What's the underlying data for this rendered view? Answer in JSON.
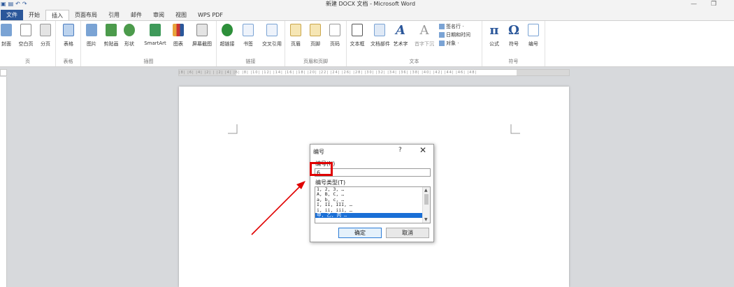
{
  "window": {
    "title": "新建 DOCX 文档 - Microsoft Word",
    "minimize_glyph": "—",
    "restore_glyph": "❐"
  },
  "tabs": [
    {
      "label": "文件"
    },
    {
      "label": "开始"
    },
    {
      "label": "插入"
    },
    {
      "label": "页面布局"
    },
    {
      "label": "引用"
    },
    {
      "label": "邮件"
    },
    {
      "label": "审阅"
    },
    {
      "label": "视图"
    },
    {
      "label": "WPS PDF"
    }
  ],
  "ribbon": {
    "groups": [
      {
        "label": "页",
        "buttons": [
          "封面",
          "空白页",
          "分页"
        ]
      },
      {
        "label": "表格",
        "buttons": [
          "表格"
        ]
      },
      {
        "label": "插图",
        "buttons": [
          "图片",
          "剪贴画",
          "形状",
          "SmartArt",
          "图表",
          "屏幕截图"
        ]
      },
      {
        "label": "链接",
        "buttons": [
          "超链接",
          "书签",
          "交叉引用"
        ]
      },
      {
        "label": "页眉和页脚",
        "buttons": [
          "页眉",
          "页脚",
          "页码"
        ]
      },
      {
        "label": "文本",
        "buttons": [
          "文本框",
          "文档部件",
          "艺术字",
          "首字下沉"
        ]
      },
      {
        "label": "符号",
        "buttons": [
          "公式",
          "符号",
          "编号"
        ]
      }
    ],
    "text_small": [
      "签名行 ·",
      "日期和时间",
      "对象 ·"
    ],
    "symbols": {
      "pi": "π",
      "omega": "Ω"
    },
    "colors": {
      "file_tab": "#2b579a",
      "icon_blue": "#7aa3d4",
      "icon_orange": "#e8a33b",
      "icon_green": "#4c9b4c"
    }
  },
  "ruler": {
    "ticks": "|8| |6| |4| |2| | |2| |4| |6| |8| |10| |12| |14| |16| |18| |20| |22| |24| |26| |28| |30| |32| |34| |36| |38| |40| |42| |44| |46| |48|"
  },
  "dialog": {
    "title": "编号",
    "help": "?",
    "close": "✕",
    "number_label": "编号(N)",
    "number_value": "6",
    "type_label": "编号类型(T)",
    "options": [
      "1, 2, 3, …",
      "A, B, C, …",
      "a, b, c, …",
      "I, II, III, …",
      "i, ii, iii, …",
      "甲, 乙, 丙 …"
    ],
    "selected_index": 5,
    "ok_label": "确定",
    "cancel_label": "取消"
  },
  "annotation": {
    "color": "#e00000"
  }
}
